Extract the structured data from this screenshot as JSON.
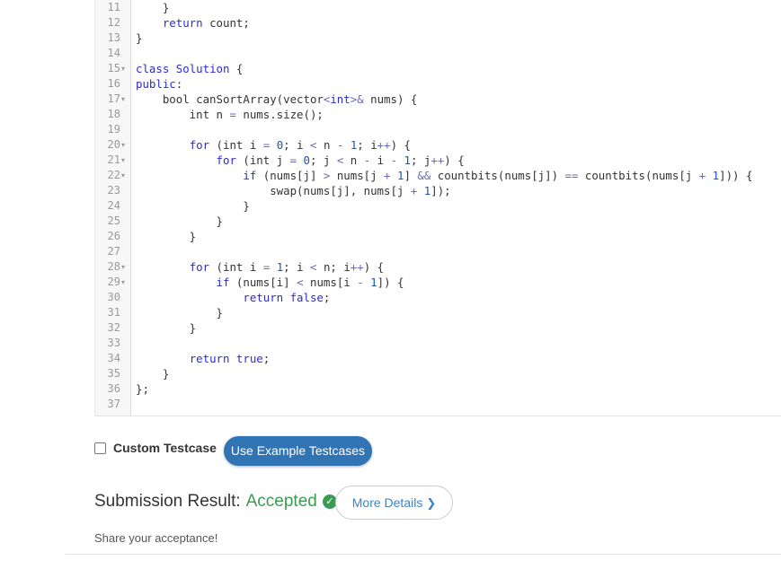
{
  "editor": {
    "lines": [
      {
        "n": "11",
        "fold": false,
        "tokens": [
          [
            "    }",
            ""
          ]
        ]
      },
      {
        "n": "12",
        "fold": false,
        "tokens": [
          [
            "    ",
            ""
          ],
          [
            "return",
            "kw"
          ],
          [
            " count;",
            ""
          ]
        ]
      },
      {
        "n": "13",
        "fold": false,
        "tokens": [
          [
            "}",
            ""
          ]
        ]
      },
      {
        "n": "14",
        "fold": false,
        "tokens": []
      },
      {
        "n": "15",
        "fold": true,
        "tokens": [
          [
            "class",
            "kw"
          ],
          [
            " ",
            ""
          ],
          [
            "Solution",
            "kw"
          ],
          [
            " {",
            ""
          ]
        ]
      },
      {
        "n": "16",
        "fold": false,
        "tokens": [
          [
            "public",
            "kw"
          ],
          [
            ":",
            ""
          ]
        ]
      },
      {
        "n": "17",
        "fold": true,
        "tokens": [
          [
            "    bool canSortArray(vector",
            ""
          ],
          [
            "<",
            "op"
          ],
          [
            "int",
            "kw"
          ],
          [
            ">",
            "op"
          ],
          [
            "&",
            "op"
          ],
          [
            " nums) {",
            ""
          ]
        ]
      },
      {
        "n": "18",
        "fold": false,
        "tokens": [
          [
            "        int n ",
            ""
          ],
          [
            "=",
            "op"
          ],
          [
            " nums.size();",
            ""
          ]
        ]
      },
      {
        "n": "19",
        "fold": false,
        "tokens": []
      },
      {
        "n": "20",
        "fold": true,
        "tokens": [
          [
            "        ",
            ""
          ],
          [
            "for",
            "kw"
          ],
          [
            " (int i ",
            ""
          ],
          [
            "=",
            "op"
          ],
          [
            " ",
            ""
          ],
          [
            "0",
            "num"
          ],
          [
            "; i ",
            ""
          ],
          [
            "<",
            "op"
          ],
          [
            " n ",
            ""
          ],
          [
            "-",
            "op"
          ],
          [
            " ",
            ""
          ],
          [
            "1",
            "num"
          ],
          [
            "; i",
            ""
          ],
          [
            "++",
            "op"
          ],
          [
            ") {",
            ""
          ]
        ]
      },
      {
        "n": "21",
        "fold": true,
        "tokens": [
          [
            "            ",
            ""
          ],
          [
            "for",
            "kw"
          ],
          [
            " (int j ",
            ""
          ],
          [
            "=",
            "op"
          ],
          [
            " ",
            ""
          ],
          [
            "0",
            "num"
          ],
          [
            "; j ",
            ""
          ],
          [
            "<",
            "op"
          ],
          [
            " n ",
            ""
          ],
          [
            "-",
            "op"
          ],
          [
            " i ",
            ""
          ],
          [
            "-",
            "op"
          ],
          [
            " ",
            ""
          ],
          [
            "1",
            "num"
          ],
          [
            "; j",
            ""
          ],
          [
            "++",
            "op"
          ],
          [
            ") {",
            ""
          ]
        ]
      },
      {
        "n": "22",
        "fold": true,
        "tokens": [
          [
            "                ",
            ""
          ],
          [
            "if",
            "kw"
          ],
          [
            " (nums[j] ",
            ""
          ],
          [
            ">",
            "op"
          ],
          [
            " nums[j ",
            ""
          ],
          [
            "+",
            "op"
          ],
          [
            " ",
            ""
          ],
          [
            "1",
            "num"
          ],
          [
            "] ",
            ""
          ],
          [
            "&&",
            "op"
          ],
          [
            " countbits(nums[j]) ",
            ""
          ],
          [
            "==",
            "op"
          ],
          [
            " countbits(nums[j ",
            ""
          ],
          [
            "+",
            "op"
          ],
          [
            " ",
            ""
          ],
          [
            "1",
            "num"
          ],
          [
            "])) {",
            ""
          ]
        ]
      },
      {
        "n": "23",
        "fold": false,
        "tokens": [
          [
            "                    swap(nums[j], nums[j ",
            ""
          ],
          [
            "+",
            "op"
          ],
          [
            " ",
            ""
          ],
          [
            "1",
            "num"
          ],
          [
            "]);",
            ""
          ]
        ]
      },
      {
        "n": "24",
        "fold": false,
        "tokens": [
          [
            "                }",
            ""
          ]
        ]
      },
      {
        "n": "25",
        "fold": false,
        "tokens": [
          [
            "            }",
            ""
          ]
        ]
      },
      {
        "n": "26",
        "fold": false,
        "tokens": [
          [
            "        }",
            ""
          ]
        ]
      },
      {
        "n": "27",
        "fold": false,
        "tokens": []
      },
      {
        "n": "28",
        "fold": true,
        "tokens": [
          [
            "        ",
            ""
          ],
          [
            "for",
            "kw"
          ],
          [
            " (int i ",
            ""
          ],
          [
            "=",
            "op"
          ],
          [
            " ",
            ""
          ],
          [
            "1",
            "num"
          ],
          [
            "; i ",
            ""
          ],
          [
            "<",
            "op"
          ],
          [
            " n; i",
            ""
          ],
          [
            "++",
            "op"
          ],
          [
            ") {",
            ""
          ]
        ]
      },
      {
        "n": "29",
        "fold": true,
        "tokens": [
          [
            "            ",
            ""
          ],
          [
            "if",
            "kw"
          ],
          [
            " (nums[i] ",
            ""
          ],
          [
            "<",
            "op"
          ],
          [
            " nums[i ",
            ""
          ],
          [
            "-",
            "op"
          ],
          [
            " ",
            ""
          ],
          [
            "1",
            "num"
          ],
          [
            "]) {",
            ""
          ]
        ]
      },
      {
        "n": "30",
        "fold": false,
        "tokens": [
          [
            "                ",
            ""
          ],
          [
            "return",
            "kw"
          ],
          [
            " ",
            ""
          ],
          [
            "false",
            "kw"
          ],
          [
            ";",
            ""
          ]
        ]
      },
      {
        "n": "31",
        "fold": false,
        "tokens": [
          [
            "            }",
            ""
          ]
        ]
      },
      {
        "n": "32",
        "fold": false,
        "tokens": [
          [
            "        }",
            ""
          ]
        ]
      },
      {
        "n": "33",
        "fold": false,
        "tokens": []
      },
      {
        "n": "34",
        "fold": false,
        "tokens": [
          [
            "        ",
            ""
          ],
          [
            "return",
            "kw"
          ],
          [
            " ",
            ""
          ],
          [
            "true",
            "kw"
          ],
          [
            ";",
            ""
          ]
        ]
      },
      {
        "n": "35",
        "fold": false,
        "tokens": [
          [
            "    }",
            ""
          ]
        ]
      },
      {
        "n": "36",
        "fold": false,
        "tokens": [
          [
            "};",
            ""
          ]
        ]
      },
      {
        "n": "37",
        "fold": false,
        "tokens": []
      }
    ],
    "fold_glyph": "▾"
  },
  "testcase": {
    "custom_label": "Custom Testcase",
    "custom_checked": false,
    "example_button": "Use Example Testcases"
  },
  "result": {
    "label": "Submission Result:",
    "status": "Accepted",
    "status_icon": "check-circle-icon",
    "details_button": "More Details",
    "details_chevron": "❯"
  },
  "share_text": "Share your acceptance!",
  "colors": {
    "accent": "#3174b4",
    "accepted": "#3c9b52",
    "link": "#3a84c9",
    "keyword": "#2b2bd6"
  }
}
